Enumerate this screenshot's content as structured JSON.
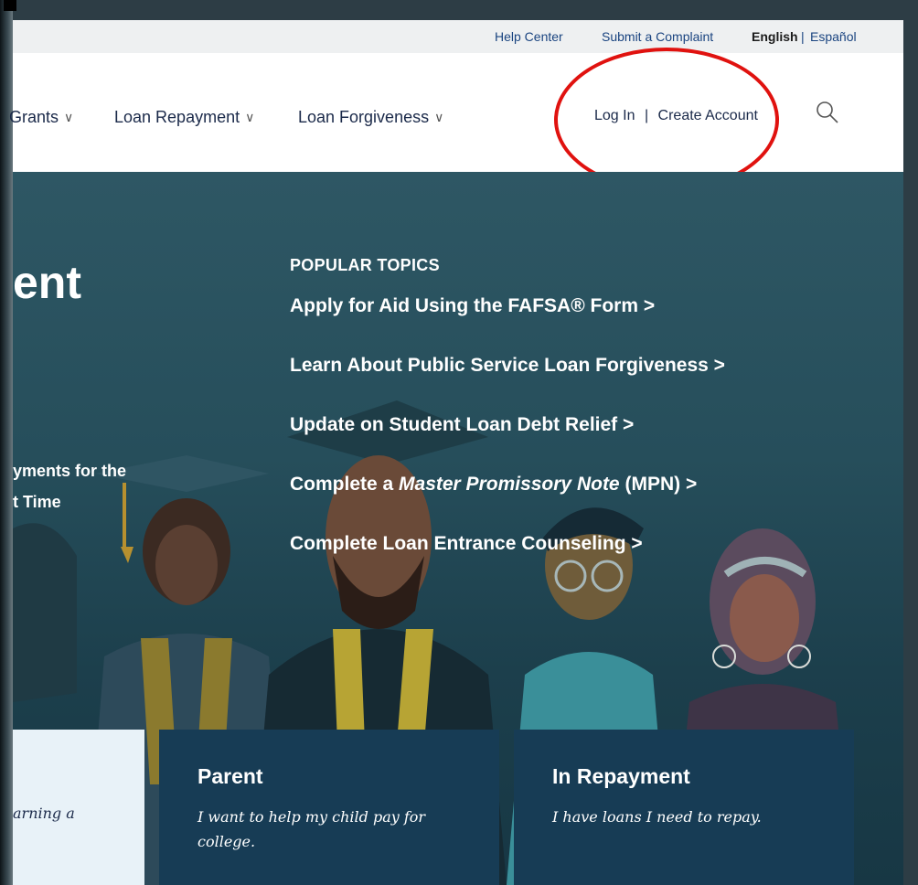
{
  "topbar": {
    "help_center": "Help Center",
    "submit_complaint": "Submit a Complaint",
    "english": "English",
    "separator": "|",
    "espanol": "Español"
  },
  "nav": {
    "grants": "Grants",
    "loan_repayment": "Loan Repayment",
    "loan_forgiveness": "Loan Forgiveness",
    "log_in": "Log In",
    "auth_separator": "|",
    "create_account": "Create Account",
    "chevron": "∨"
  },
  "hero": {
    "title_fragment": "ent",
    "sub_line1": "yments for the",
    "sub_line2": "t Time"
  },
  "popular": {
    "heading": "POPULAR TOPICS",
    "topics": [
      "Apply for Aid Using the FAFSA® Form >",
      "Learn About Public Service Loan Forgiveness >",
      "Update on Student Loan Debt Relief >",
      "Complete a ",
      "Master Promissory Note",
      " (MPN) >",
      "Complete Loan Entrance Counseling >"
    ]
  },
  "cards": {
    "student_text": "arning a",
    "parent_title": "Parent",
    "parent_desc": "I want to help my child pay for college.",
    "repay_title": "In Repayment",
    "repay_desc": "I have loans I need to repay."
  },
  "colors": {
    "hero_bg": "#264e5b",
    "card_bg": "#173c55",
    "annotation": "#e0120f",
    "link": "#1a4480"
  }
}
